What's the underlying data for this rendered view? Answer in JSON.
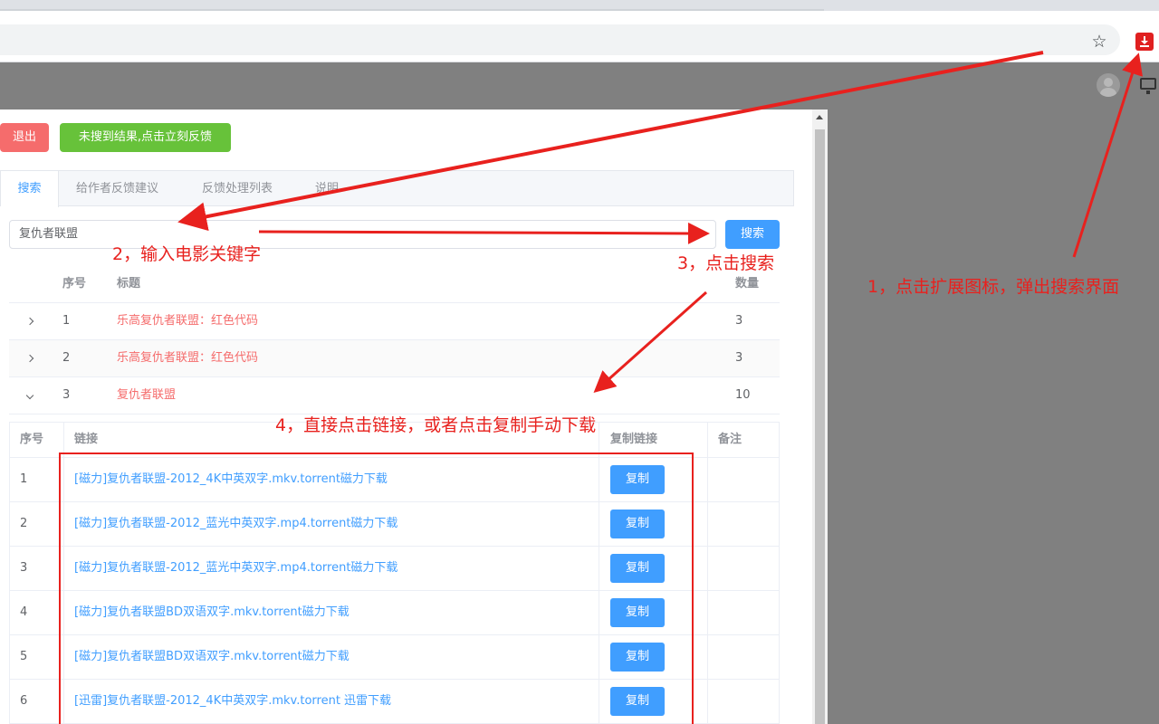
{
  "extension_icon": "download-extension-icon",
  "toolbar_icons": [
    "star-icon"
  ],
  "popup": {
    "buttons": {
      "logout": "退出",
      "feedback": "未搜到结果,点击立刻反馈"
    },
    "tabs": [
      "搜索",
      "给作者反馈建议",
      "反馈处理列表",
      "说明"
    ],
    "search": {
      "value": "复仇者联盟",
      "button": "搜索"
    },
    "results": {
      "headers": {
        "num": "序号",
        "title": "标题",
        "count": "数量"
      },
      "rows": [
        {
          "num": "1",
          "title": "乐高复仇者联盟：红色代码",
          "count": "3",
          "expanded": false
        },
        {
          "num": "2",
          "title": "乐高复仇者联盟：红色代码",
          "count": "3",
          "expanded": false
        },
        {
          "num": "3",
          "title": "复仇者联盟",
          "count": "10",
          "expanded": true
        }
      ]
    },
    "links": {
      "headers": {
        "num": "序号",
        "link": "链接",
        "copy": "复制链接",
        "note": "备注"
      },
      "copy_label": "复制",
      "rows": [
        {
          "num": "1",
          "link": "[磁力]复仇者联盟-2012_4K中英双字.mkv.torrent磁力下载"
        },
        {
          "num": "2",
          "link": "[磁力]复仇者联盟-2012_蓝光中英双字.mp4.torrent磁力下载"
        },
        {
          "num": "3",
          "link": "[磁力]复仇者联盟-2012_蓝光中英双字.mp4.torrent磁力下载"
        },
        {
          "num": "4",
          "link": "[磁力]复仇者联盟BD双语双字.mkv.torrent磁力下载"
        },
        {
          "num": "5",
          "link": "[磁力]复仇者联盟BD双语双字.mkv.torrent磁力下载"
        },
        {
          "num": "6",
          "link": "[迅雷]复仇者联盟-2012_4K中英双字.mkv.torrent 迅雷下载"
        }
      ]
    }
  },
  "annotations": {
    "step1": "1，点击扩展图标，弹出搜索界面",
    "step2": "2，输入电影关键字",
    "step3": "3，点击搜索",
    "step4": "4，直接点击链接，或者点击复制手动下载",
    "color": "#e8211e"
  },
  "colors": {
    "primary": "#409eff",
    "danger": "#f56c6c",
    "success": "#67c23a"
  }
}
